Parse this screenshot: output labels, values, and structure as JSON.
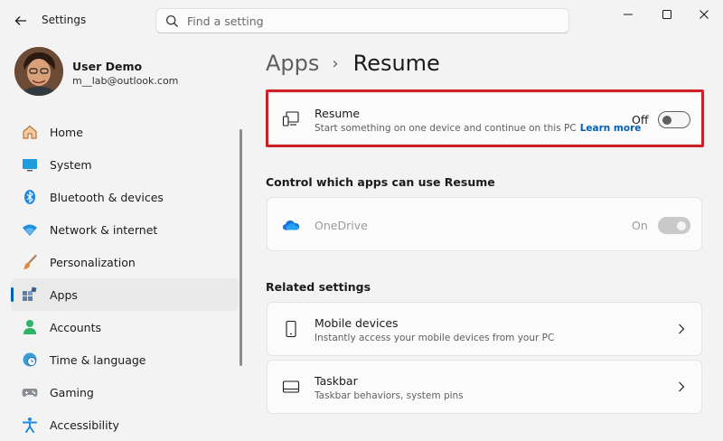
{
  "window": {
    "title": "Settings",
    "back_icon": "back-arrow-icon",
    "controls": [
      "minimize-icon",
      "maximize-icon",
      "close-icon"
    ]
  },
  "search": {
    "placeholder": "Find a setting"
  },
  "user": {
    "name": "User Demo",
    "email": "m__lab@outlook.com"
  },
  "sidebar": {
    "items": [
      {
        "label": "Home",
        "icon": "home-icon"
      },
      {
        "label": "System",
        "icon": "system-icon"
      },
      {
        "label": "Bluetooth & devices",
        "icon": "bluetooth-icon"
      },
      {
        "label": "Network & internet",
        "icon": "wifi-icon"
      },
      {
        "label": "Personalization",
        "icon": "brush-icon"
      },
      {
        "label": "Apps",
        "icon": "apps-icon",
        "active": true
      },
      {
        "label": "Accounts",
        "icon": "account-icon"
      },
      {
        "label": "Time & language",
        "icon": "clock-globe-icon"
      },
      {
        "label": "Gaming",
        "icon": "controller-icon"
      },
      {
        "label": "Accessibility",
        "icon": "accessibility-icon"
      }
    ]
  },
  "breadcrumb": {
    "parent": "Apps",
    "separator": "›",
    "current": "Resume"
  },
  "resume_card": {
    "title": "Resume",
    "subtitle": "Start something on one device and continue on this PC",
    "learn_more": "Learn more",
    "toggle_state": "Off",
    "icon": "resume-devices-icon"
  },
  "control_section": {
    "title": "Control which apps can use Resume",
    "apps": [
      {
        "name": "OneDrive",
        "toggle_state": "On",
        "icon": "onedrive-icon",
        "disabled": true
      }
    ]
  },
  "related": {
    "title": "Related settings",
    "items": [
      {
        "title": "Mobile devices",
        "subtitle": "Instantly access your mobile devices from your PC",
        "icon": "phone-icon"
      },
      {
        "title": "Taskbar",
        "subtitle": "Taskbar behaviors, system pins",
        "icon": "taskbar-icon"
      }
    ]
  },
  "colors": {
    "accent": "#005fb8",
    "highlight_border": "#d02027",
    "background": "#f3f3f3"
  }
}
